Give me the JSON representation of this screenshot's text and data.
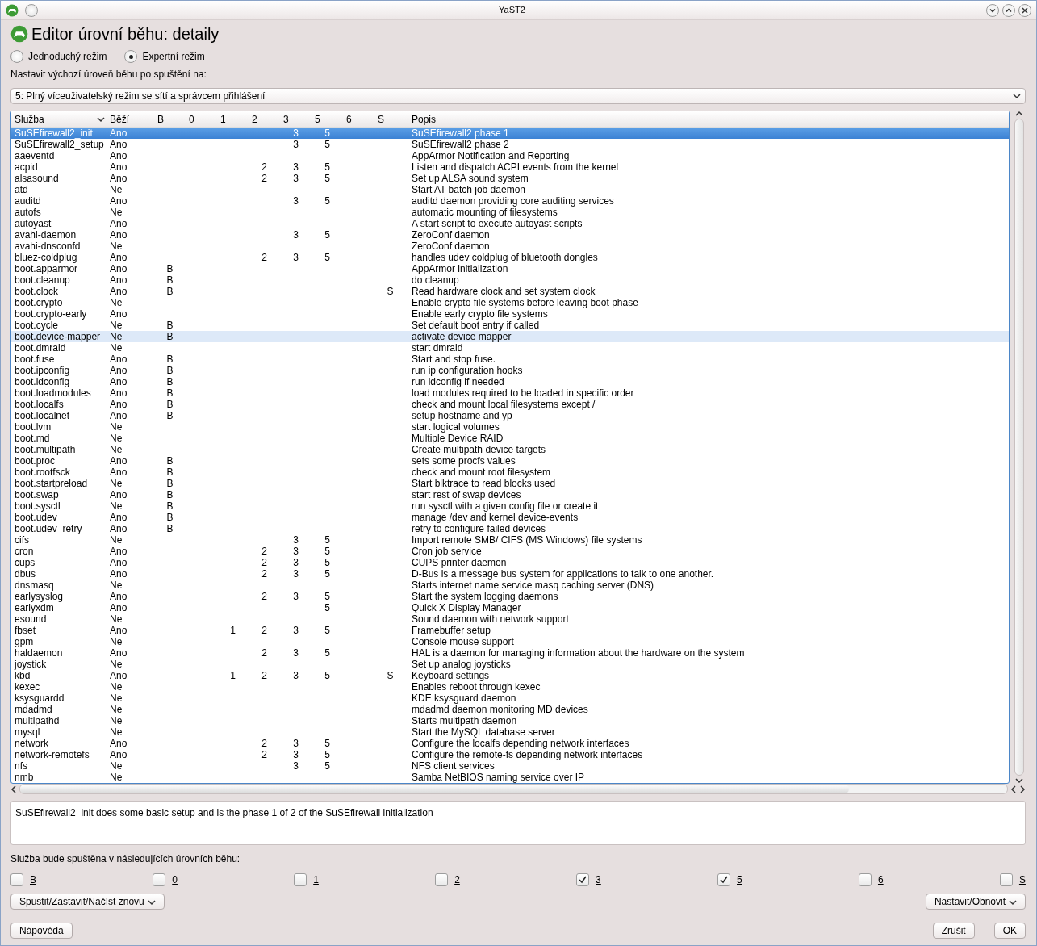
{
  "window": {
    "title": "YaST2"
  },
  "heading": "Editor úrovní běhu: detaily",
  "modes": [
    {
      "label": "Jednoduchý režim",
      "selected": false
    },
    {
      "label": "Expertní režim",
      "selected": true
    }
  ],
  "default_runlevel": {
    "label": "Nastavit výchozí úroveň běhu po spuštění na:",
    "value": "5: Plný víceuživatelský režim se sítí a správcem přihlášení"
  },
  "table": {
    "columns": [
      "Služba",
      "Běží",
      "B",
      "0",
      "1",
      "2",
      "3",
      "5",
      "6",
      "S",
      "Popis"
    ],
    "rows": [
      {
        "service": "SuSEfirewall2_init",
        "running": "Ano",
        "levels": {
          "r3": "3",
          "r5": "5"
        },
        "description": "SuSEfirewall2 phase 1",
        "selected": true,
        "hovered": false
      },
      {
        "service": "SuSEfirewall2_setup",
        "running": "Ano",
        "levels": {
          "r3": "3",
          "r5": "5"
        },
        "description": "SuSEfirewall2 phase 2",
        "selected": false,
        "hovered": false
      },
      {
        "service": "aaeventd",
        "running": "Ano",
        "levels": {},
        "description": "AppArmor Notification and Reporting",
        "selected": false,
        "hovered": false
      },
      {
        "service": "acpid",
        "running": "Ano",
        "levels": {
          "r2": "2",
          "r3": "3",
          "r5": "5"
        },
        "description": "Listen and dispatch ACPI events from the kernel",
        "selected": false,
        "hovered": false
      },
      {
        "service": "alsasound",
        "running": "Ano",
        "levels": {
          "r2": "2",
          "r3": "3",
          "r5": "5"
        },
        "description": "Set up ALSA sound system",
        "selected": false,
        "hovered": false
      },
      {
        "service": "atd",
        "running": "Ne",
        "levels": {},
        "description": "Start AT batch job daemon",
        "selected": false,
        "hovered": false
      },
      {
        "service": "auditd",
        "running": "Ano",
        "levels": {
          "r3": "3",
          "r5": "5"
        },
        "description": "auditd daemon providing core auditing services",
        "selected": false,
        "hovered": false
      },
      {
        "service": "autofs",
        "running": "Ne",
        "levels": {},
        "description": "automatic mounting of filesystems",
        "selected": false,
        "hovered": false
      },
      {
        "service": "autoyast",
        "running": "Ano",
        "levels": {},
        "description": "A start script to execute autoyast scripts",
        "selected": false,
        "hovered": false
      },
      {
        "service": "avahi-daemon",
        "running": "Ano",
        "levels": {
          "r3": "3",
          "r5": "5"
        },
        "description": "ZeroConf daemon",
        "selected": false,
        "hovered": false
      },
      {
        "service": "avahi-dnsconfd",
        "running": "Ne",
        "levels": {},
        "description": "ZeroConf daemon",
        "selected": false,
        "hovered": false
      },
      {
        "service": "bluez-coldplug",
        "running": "Ano",
        "levels": {
          "r2": "2",
          "r3": "3",
          "r5": "5"
        },
        "description": "handles udev coldplug of bluetooth dongles",
        "selected": false,
        "hovered": false
      },
      {
        "service": "boot.apparmor",
        "running": "Ano",
        "levels": {
          "b": "B"
        },
        "description": "AppArmor initialization",
        "selected": false,
        "hovered": false
      },
      {
        "service": "boot.cleanup",
        "running": "Ano",
        "levels": {
          "b": "B"
        },
        "description": "do cleanup",
        "selected": false,
        "hovered": false
      },
      {
        "service": "boot.clock",
        "running": "Ano",
        "levels": {
          "b": "B",
          "s": "S"
        },
        "description": "Read hardware clock and set system clock",
        "selected": false,
        "hovered": false
      },
      {
        "service": "boot.crypto",
        "running": "Ne",
        "levels": {},
        "description": "Enable crypto file systems before leaving boot phase",
        "selected": false,
        "hovered": false
      },
      {
        "service": "boot.crypto-early",
        "running": "Ano",
        "levels": {},
        "description": "Enable early crypto file systems",
        "selected": false,
        "hovered": false
      },
      {
        "service": "boot.cycle",
        "running": "Ne",
        "levels": {
          "b": "B"
        },
        "description": "Set default boot entry if called",
        "selected": false,
        "hovered": false
      },
      {
        "service": "boot.device-mapper",
        "running": "Ne",
        "levels": {
          "b": "B"
        },
        "description": "activate device mapper",
        "selected": false,
        "hovered": true
      },
      {
        "service": "boot.dmraid",
        "running": "Ne",
        "levels": {},
        "description": "start dmraid",
        "selected": false,
        "hovered": false
      },
      {
        "service": "boot.fuse",
        "running": "Ano",
        "levels": {
          "b": "B"
        },
        "description": "Start and stop fuse.",
        "selected": false,
        "hovered": false
      },
      {
        "service": "boot.ipconfig",
        "running": "Ano",
        "levels": {
          "b": "B"
        },
        "description": "run ip configuration hooks",
        "selected": false,
        "hovered": false
      },
      {
        "service": "boot.ldconfig",
        "running": "Ano",
        "levels": {
          "b": "B"
        },
        "description": "run ldconfig if needed",
        "selected": false,
        "hovered": false
      },
      {
        "service": "boot.loadmodules",
        "running": "Ano",
        "levels": {
          "b": "B"
        },
        "description": "load modules required to be loaded in specific order",
        "selected": false,
        "hovered": false
      },
      {
        "service": "boot.localfs",
        "running": "Ano",
        "levels": {
          "b": "B"
        },
        "description": "check and mount local filesystems except /",
        "selected": false,
        "hovered": false
      },
      {
        "service": "boot.localnet",
        "running": "Ano",
        "levels": {
          "b": "B"
        },
        "description": "setup hostname and yp",
        "selected": false,
        "hovered": false
      },
      {
        "service": "boot.lvm",
        "running": "Ne",
        "levels": {},
        "description": "start logical volumes",
        "selected": false,
        "hovered": false
      },
      {
        "service": "boot.md",
        "running": "Ne",
        "levels": {},
        "description": "Multiple Device RAID",
        "selected": false,
        "hovered": false
      },
      {
        "service": "boot.multipath",
        "running": "Ne",
        "levels": {},
        "description": "Create multipath device targets",
        "selected": false,
        "hovered": false
      },
      {
        "service": "boot.proc",
        "running": "Ano",
        "levels": {
          "b": "B"
        },
        "description": "sets some procfs values",
        "selected": false,
        "hovered": false
      },
      {
        "service": "boot.rootfsck",
        "running": "Ano",
        "levels": {
          "b": "B"
        },
        "description": "check and mount root filesystem",
        "selected": false,
        "hovered": false
      },
      {
        "service": "boot.startpreload",
        "running": "Ne",
        "levels": {
          "b": "B"
        },
        "description": "Start blktrace to read blocks used",
        "selected": false,
        "hovered": false
      },
      {
        "service": "boot.swap",
        "running": "Ano",
        "levels": {
          "b": "B"
        },
        "description": "start rest of swap devices",
        "selected": false,
        "hovered": false
      },
      {
        "service": "boot.sysctl",
        "running": "Ne",
        "levels": {
          "b": "B"
        },
        "description": "run sysctl with a given config file or create it",
        "selected": false,
        "hovered": false
      },
      {
        "service": "boot.udev",
        "running": "Ano",
        "levels": {
          "b": "B"
        },
        "description": "manage /dev and kernel device-events",
        "selected": false,
        "hovered": false
      },
      {
        "service": "boot.udev_retry",
        "running": "Ano",
        "levels": {
          "b": "B"
        },
        "description": "retry to configure failed devices",
        "selected": false,
        "hovered": false
      },
      {
        "service": "cifs",
        "running": "Ne",
        "levels": {
          "r3": "3",
          "r5": "5"
        },
        "description": "Import remote SMB/ CIFS (MS Windows) file systems",
        "selected": false,
        "hovered": false
      },
      {
        "service": "cron",
        "running": "Ano",
        "levels": {
          "r2": "2",
          "r3": "3",
          "r5": "5"
        },
        "description": "Cron job service",
        "selected": false,
        "hovered": false
      },
      {
        "service": "cups",
        "running": "Ano",
        "levels": {
          "r2": "2",
          "r3": "3",
          "r5": "5"
        },
        "description": "CUPS printer daemon",
        "selected": false,
        "hovered": false
      },
      {
        "service": "dbus",
        "running": "Ano",
        "levels": {
          "r2": "2",
          "r3": "3",
          "r5": "5"
        },
        "description": "D-Bus is a message bus system for applications to talk to one another.",
        "selected": false,
        "hovered": false
      },
      {
        "service": "dnsmasq",
        "running": "Ne",
        "levels": {},
        "description": "Starts internet name service masq caching server (DNS)",
        "selected": false,
        "hovered": false
      },
      {
        "service": "earlysyslog",
        "running": "Ano",
        "levels": {
          "r2": "2",
          "r3": "3",
          "r5": "5"
        },
        "description": "Start the system logging daemons",
        "selected": false,
        "hovered": false
      },
      {
        "service": "earlyxdm",
        "running": "Ano",
        "levels": {
          "r5": "5"
        },
        "description": "Quick X Display Manager",
        "selected": false,
        "hovered": false
      },
      {
        "service": "esound",
        "running": "Ne",
        "levels": {},
        "description": "Sound daemon with network support",
        "selected": false,
        "hovered": false
      },
      {
        "service": "fbset",
        "running": "Ano",
        "levels": {
          "r1": "1",
          "r2": "2",
          "r3": "3",
          "r5": "5"
        },
        "description": "Framebuffer setup",
        "selected": false,
        "hovered": false
      },
      {
        "service": "gpm",
        "running": "Ne",
        "levels": {},
        "description": "Console mouse support",
        "selected": false,
        "hovered": false
      },
      {
        "service": "haldaemon",
        "running": "Ano",
        "levels": {
          "r2": "2",
          "r3": "3",
          "r5": "5"
        },
        "description": "HAL is a daemon for managing information about the hardware on the system",
        "selected": false,
        "hovered": false
      },
      {
        "service": "joystick",
        "running": "Ne",
        "levels": {},
        "description": "Set up analog joysticks",
        "selected": false,
        "hovered": false
      },
      {
        "service": "kbd",
        "running": "Ano",
        "levels": {
          "r1": "1",
          "r2": "2",
          "r3": "3",
          "r5": "5",
          "s": "S"
        },
        "description": "Keyboard settings",
        "selected": false,
        "hovered": false
      },
      {
        "service": "kexec",
        "running": "Ne",
        "levels": {},
        "description": "Enables reboot through kexec",
        "selected": false,
        "hovered": false
      },
      {
        "service": "ksysguardd",
        "running": "Ne",
        "levels": {},
        "description": "KDE ksysguard daemon",
        "selected": false,
        "hovered": false
      },
      {
        "service": "mdadmd",
        "running": "Ne",
        "levels": {},
        "description": "mdadmd daemon monitoring MD devices",
        "selected": false,
        "hovered": false
      },
      {
        "service": "multipathd",
        "running": "Ne",
        "levels": {},
        "description": "Starts multipath daemon",
        "selected": false,
        "hovered": false
      },
      {
        "service": "mysql",
        "running": "Ne",
        "levels": {},
        "description": "Start the MySQL database server",
        "selected": false,
        "hovered": false
      },
      {
        "service": "network",
        "running": "Ano",
        "levels": {
          "r2": "2",
          "r3": "3",
          "r5": "5"
        },
        "description": "Configure the localfs depending network interfaces",
        "selected": false,
        "hovered": false
      },
      {
        "service": "network-remotefs",
        "running": "Ano",
        "levels": {
          "r2": "2",
          "r3": "3",
          "r5": "5"
        },
        "description": "Configure the remote-fs depending network interfaces",
        "selected": false,
        "hovered": false
      },
      {
        "service": "nfs",
        "running": "Ne",
        "levels": {
          "r3": "3",
          "r5": "5"
        },
        "description": "NFS client services",
        "selected": false,
        "hovered": false
      },
      {
        "service": "nmb",
        "running": "Ne",
        "levels": {},
        "description": "Samba NetBIOS naming service over IP",
        "selected": false,
        "hovered": false
      }
    ]
  },
  "detail": "SuSEfirewall2_init does some basic setup and is the phase 1 of 2 of the SuSEfirewall initialization",
  "runlevels": {
    "label": "Služba bude spuštěna v následujících úrovních běhu:",
    "options": [
      {
        "label": "B",
        "checked": false
      },
      {
        "label": "0",
        "checked": false
      },
      {
        "label": "1",
        "checked": false
      },
      {
        "label": "2",
        "checked": false
      },
      {
        "label": "3",
        "checked": true
      },
      {
        "label": "5",
        "checked": true
      },
      {
        "label": "6",
        "checked": false
      },
      {
        "label": "S",
        "checked": false
      }
    ]
  },
  "buttons": {
    "start_stop": "Spustit/Zastavit/Načíst znovu",
    "set_reset": "Nastavit/Obnovit",
    "help": "Nápověda",
    "cancel": "Zrušit",
    "ok": "OK"
  }
}
